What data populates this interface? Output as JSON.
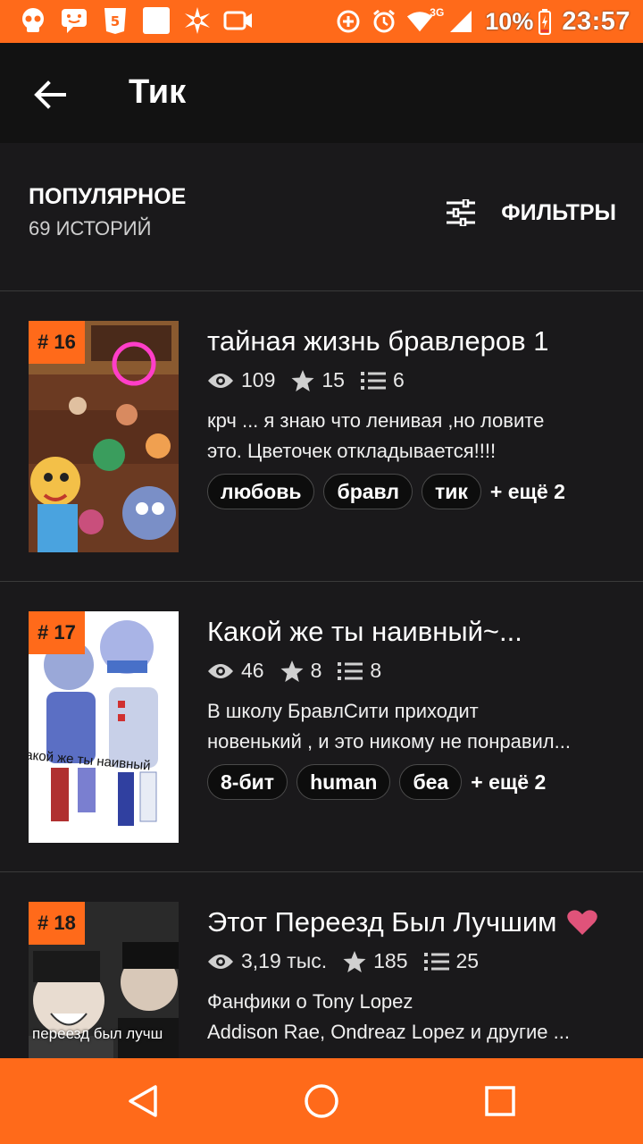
{
  "status_bar": {
    "battery": "10%",
    "time": "23:57",
    "network": "3G"
  },
  "app_bar": {
    "title": "Тик"
  },
  "list_header": {
    "sort": "ПОПУЛЯРНОЕ",
    "count": "69 ИСТОРИЙ",
    "filters_label": "ФИЛЬТРЫ"
  },
  "stories": [
    {
      "rank": "# 16",
      "title": "тайная жизнь бравлеров 1",
      "views": "109",
      "stars": "15",
      "parts": "6",
      "desc_line1": "крч ... я знаю что ленивая ,но ловите",
      "desc_line2": "это. Цветочек откладывается!!!!",
      "tags": [
        "любовь",
        "бравл",
        "тик"
      ],
      "more": "+ ещё 2"
    },
    {
      "rank": "# 17",
      "title": "Какой же ты наивный~...",
      "views": "46",
      "stars": "8",
      "parts": "8",
      "desc_line1": "В школу БравлСити приходит",
      "desc_line2": "новенький , и это никому не понравил...",
      "tags": [
        "8-бит",
        "human",
        "беа"
      ],
      "more": "+ ещё 2",
      "cover_caption": "акой же ты наивный"
    },
    {
      "rank": "# 18",
      "title": "Этот Переезд Был Лучшим",
      "views": "3,19 тыс.",
      "stars": "185",
      "parts": "25",
      "desc_line1": "Фанфики о Tony Lopez",
      "desc_line2": "Addison Rae, Ondreaz Lopez и другие ...",
      "cover_caption": "переезд был лучш"
    }
  ],
  "colors": {
    "accent": "#ff6a1a",
    "background": "#121212",
    "card": "#1a191b",
    "heart": "#e0537a"
  },
  "icons": {
    "back": "arrow-left-icon",
    "filters": "sliders-icon",
    "views": "eye-icon",
    "stars": "star-icon",
    "parts": "list-icon",
    "heart": "heart-icon"
  }
}
